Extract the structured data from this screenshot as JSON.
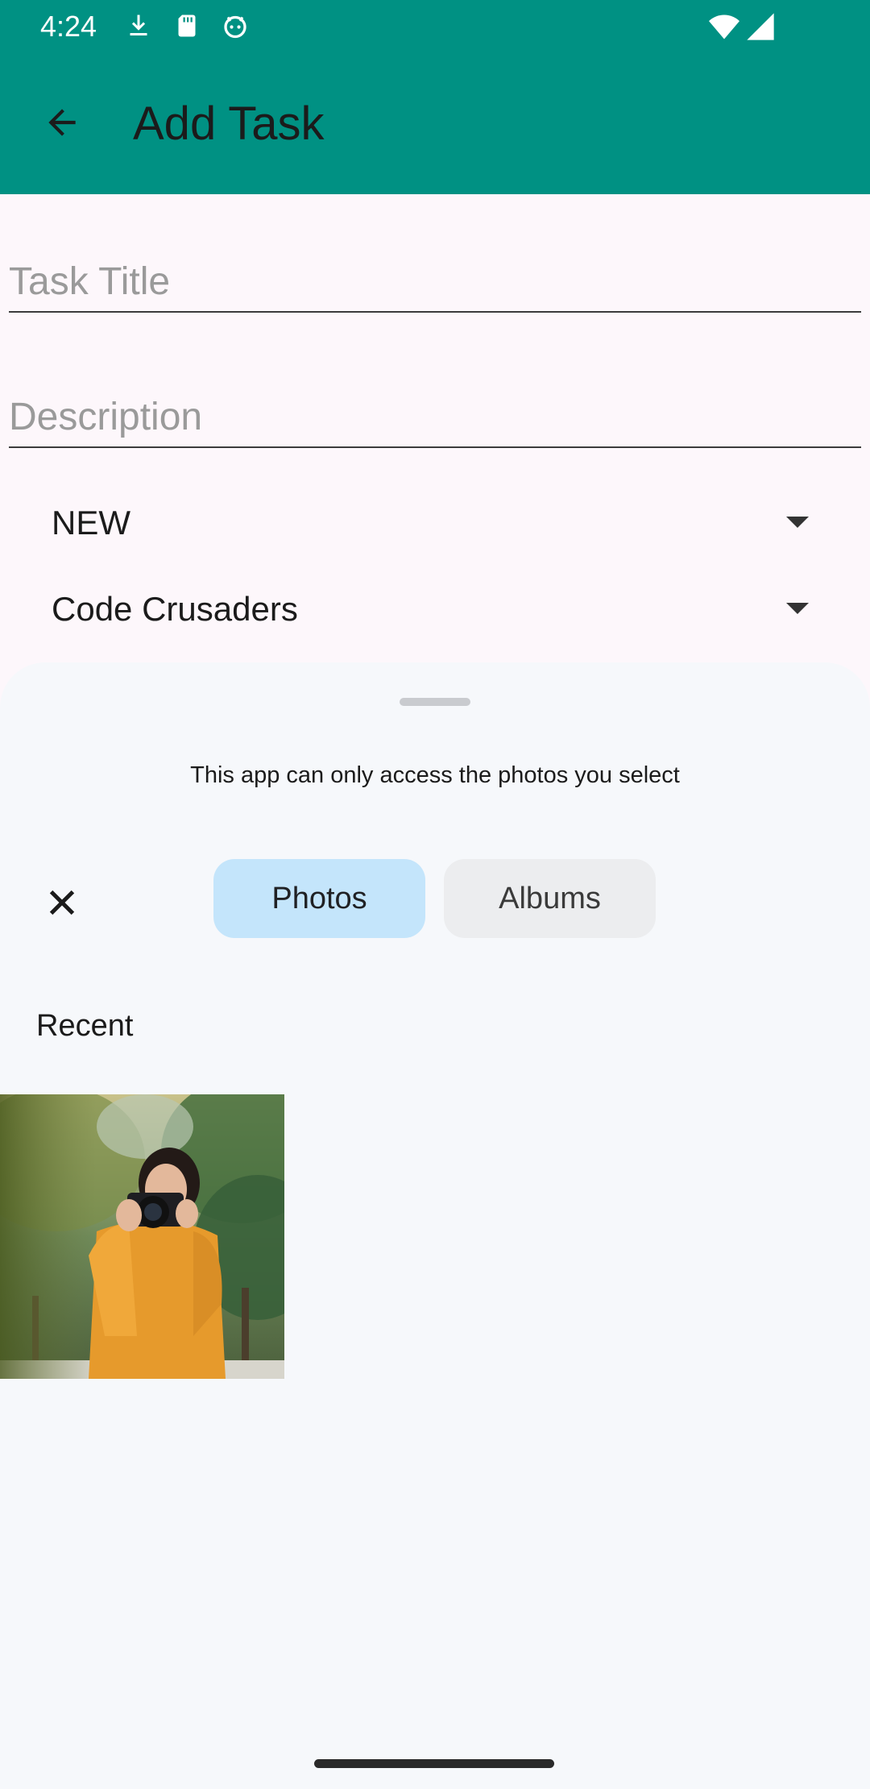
{
  "status_bar": {
    "time": "4:24",
    "icons_left": [
      "download-icon",
      "sd-card-icon",
      "android-face-icon"
    ],
    "icons_right": [
      "wifi-icon",
      "signal-icon"
    ]
  },
  "app_bar": {
    "title": "Add Task",
    "back_icon": "arrow-back-icon",
    "color": "#009183"
  },
  "form": {
    "title_placeholder": "Task Title",
    "description_placeholder": "Description",
    "status_value": "NEW",
    "team_value": "Code Crusaders"
  },
  "photo_picker": {
    "notice": "This app can only access the photos you select",
    "close_icon": "close-icon",
    "tabs": [
      {
        "label": "Photos",
        "selected": true
      },
      {
        "label": "Albums",
        "selected": false
      }
    ],
    "section_label": "Recent",
    "selected_tab_color": "#c4e5fb"
  }
}
